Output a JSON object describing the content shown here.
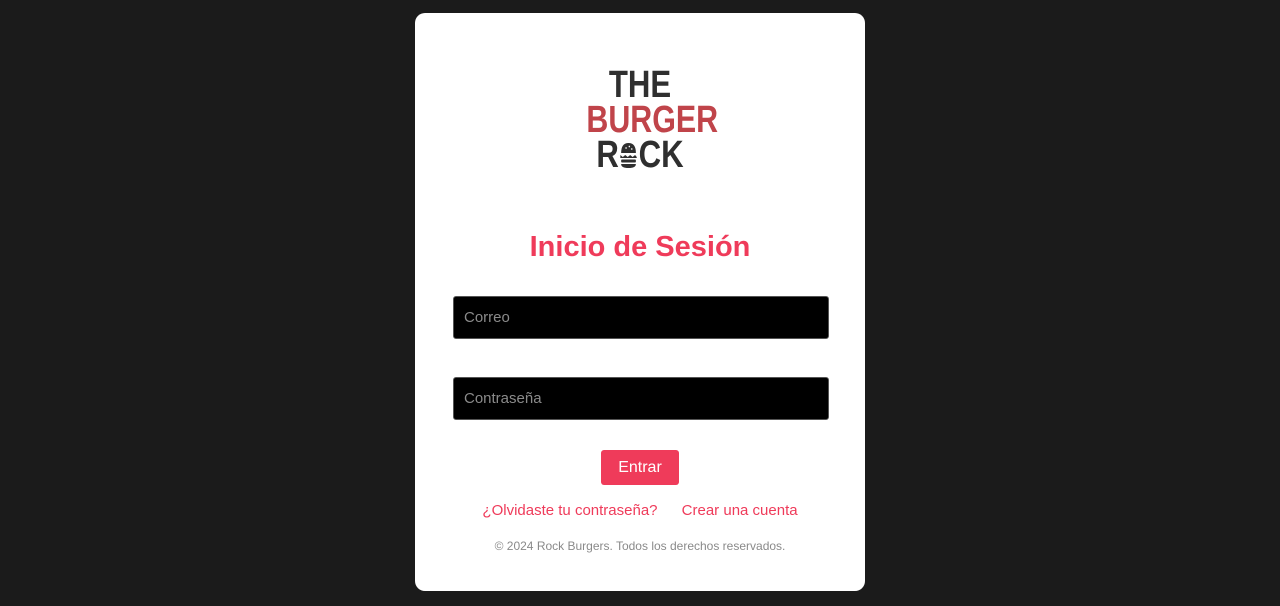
{
  "logo": {
    "line1": "THE",
    "line2": "BURGER",
    "line3_start": "R",
    "line3_end": "CK",
    "colors": {
      "dark": "#2f2f2f",
      "red": "#c0444a"
    }
  },
  "login": {
    "title": "Inicio de Sesión",
    "email_placeholder": "Correo",
    "password_placeholder": "Contraseña",
    "submit_label": "Entrar",
    "forgot_label": "¿Olvidaste tu contraseña?",
    "register_label": "Crear una cuenta"
  },
  "footer": {
    "text": "© 2024 Rock Burgers. Todos los derechos reservados."
  },
  "colors": {
    "accent": "#ef3b5a",
    "page_background": "#1b1b1b",
    "card_background": "#ffffff",
    "input_background": "#000000"
  }
}
